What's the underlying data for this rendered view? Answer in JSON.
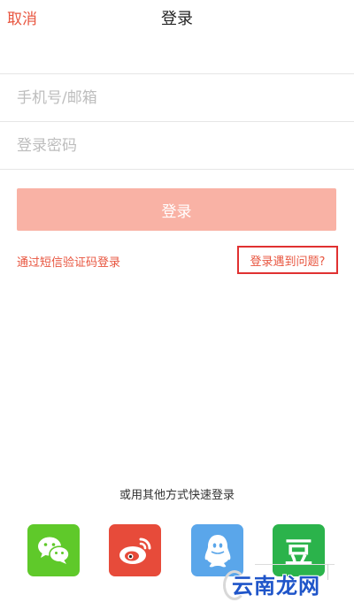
{
  "nav": {
    "cancel_label": "取消",
    "title": "登录"
  },
  "form": {
    "account_placeholder": "手机号/邮箱",
    "password_placeholder": "登录密码"
  },
  "login_button_label": "登录",
  "links": {
    "sms_login": "通过短信验证码登录",
    "login_problem": "登录遇到问题?"
  },
  "other_login": {
    "title": "或用其他方式快速登录",
    "providers": [
      "wechat-icon",
      "weibo-icon",
      "qq-icon",
      "douban-icon"
    ],
    "douban_glyph": "豆"
  },
  "colors": {
    "accent": "#e8553f",
    "login_button": "#f9b2a5",
    "highlight_box": "#e03131",
    "wechat": "#5fc92a",
    "weibo": "#e74b3a",
    "qq": "#5aa6ea",
    "douban": "#2bb34b"
  },
  "watermark": {
    "text": "云南龙网"
  }
}
